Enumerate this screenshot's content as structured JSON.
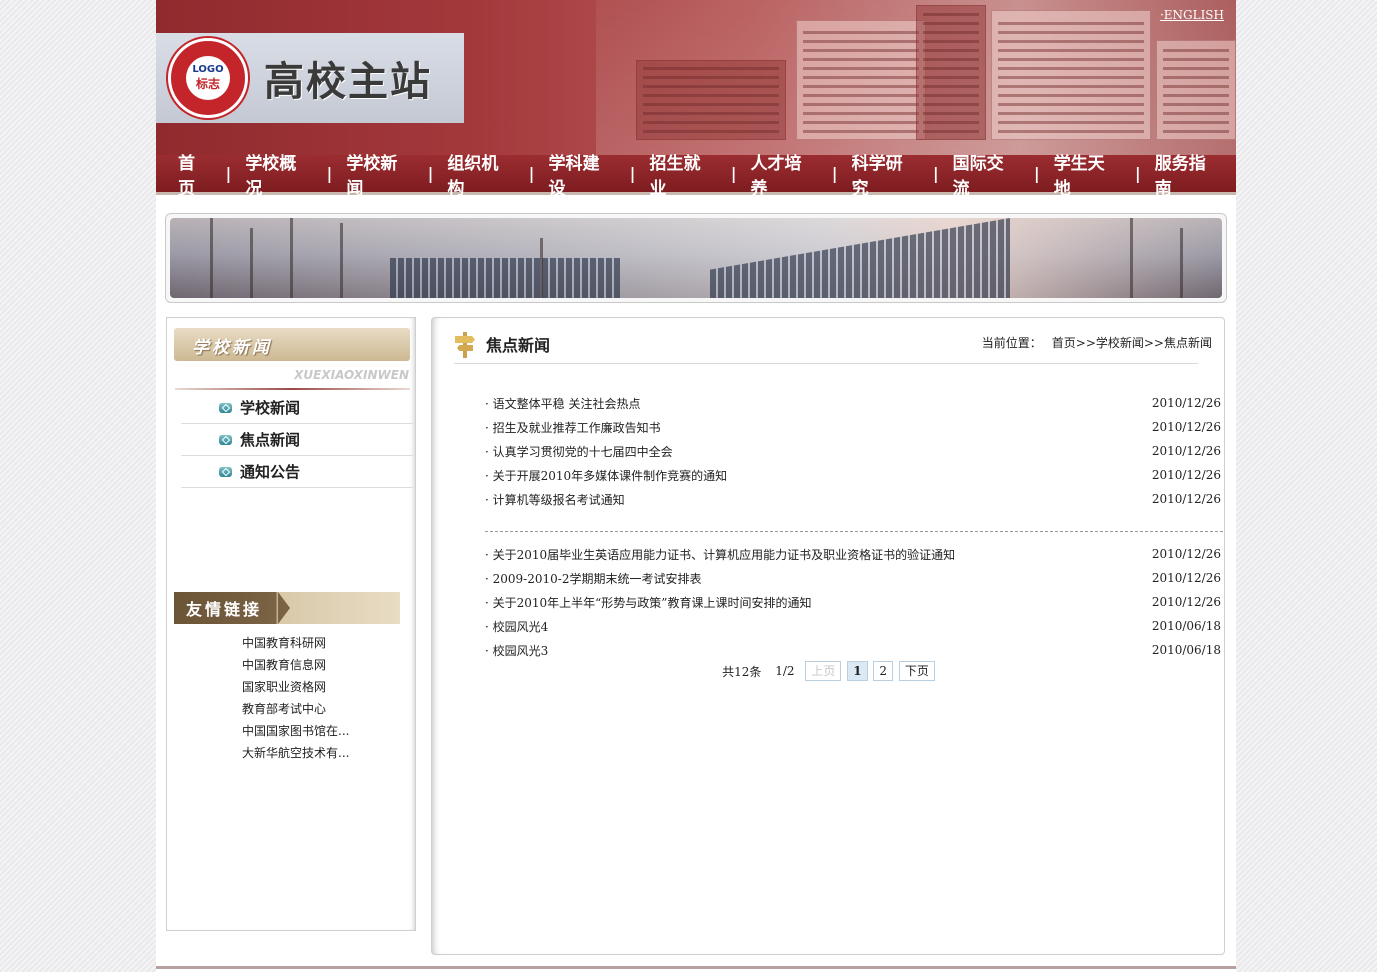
{
  "header": {
    "site_title": "高校主站",
    "logo_top": "LOGO",
    "logo_bottom": "标志",
    "english_link": "·ENGLISH"
  },
  "nav": {
    "items": [
      "首页",
      "学校概况",
      "学校新闻",
      "组织机构",
      "学科建设",
      "招生就业",
      "人才培养",
      "科学研究",
      "国际交流",
      "学生天地",
      "服务指南"
    ]
  },
  "sidebar": {
    "title": "学校新闻",
    "subtitle": "XUEXIAOXINWEN",
    "items": [
      "学校新闻",
      "焦点新闻",
      "通知公告"
    ],
    "links_title": "友情链接",
    "links": [
      "中国教育科研网",
      "中国教育信息网",
      "国家职业资格网",
      "教育部考试中心",
      "中国国家图书馆在...",
      "大新华航空技术有..."
    ]
  },
  "main": {
    "title": "焦点新闻",
    "breadcrumb_label": "当前位置：",
    "breadcrumb_path": "首页>>学校新闻>>焦点新闻",
    "news_group1": [
      {
        "title": "· 语文整体平稳  关注社会热点",
        "date": "2010/12/26"
      },
      {
        "title": "· 招生及就业推荐工作廉政告知书",
        "date": "2010/12/26"
      },
      {
        "title": "· 认真学习贯彻党的十七届四中全会",
        "date": "2010/12/26"
      },
      {
        "title": "· 关于开展2010年多媒体课件制作竞赛的通知",
        "date": "2010/12/26"
      },
      {
        "title": "· 计算机等级报名考试通知",
        "date": "2010/12/26"
      }
    ],
    "news_group2": [
      {
        "title": "· 关于2010届毕业生英语应用能力证书、计算机应用能力证书及职业资格证书的验证通知",
        "date": "2010/12/26"
      },
      {
        "title": "· 2009-2010-2学期期末统一考试安排表",
        "date": "2010/12/26"
      },
      {
        "title": "· 关于2010年上半年“形势与政策”教育课上课时间安排的通知",
        "date": "2010/12/26"
      },
      {
        "title": "· 校园风光4",
        "date": "2010/06/18"
      },
      {
        "title": "· 校园风光3",
        "date": "2010/06/18"
      }
    ],
    "pager": {
      "total": "共12条",
      "page_of": "1/2",
      "prev": "上页",
      "pages": [
        "1",
        "2"
      ],
      "next": "下页"
    }
  }
}
